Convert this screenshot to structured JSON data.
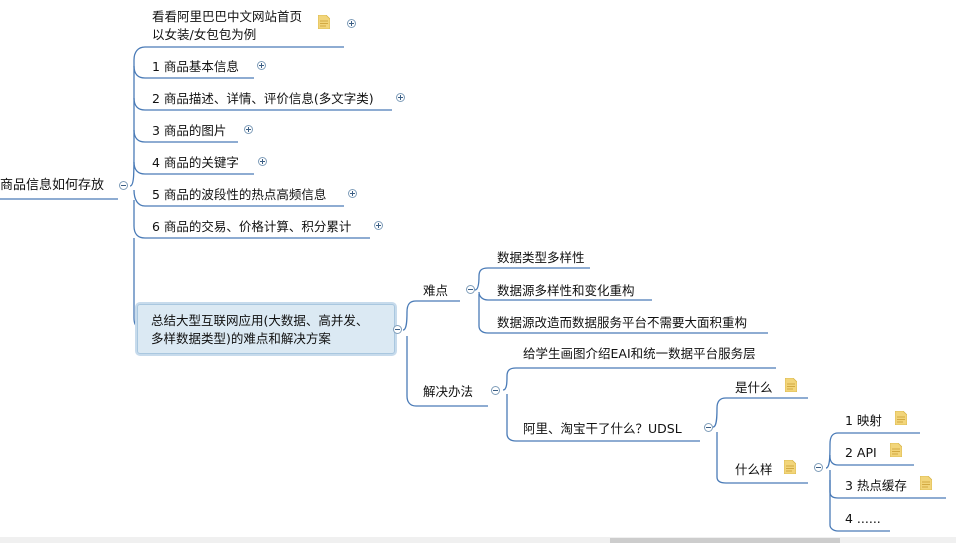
{
  "root": "商品信息如何存放",
  "topics": {
    "homepage": {
      "line1": "看看阿里巴巴中文网站首页",
      "line2": "以女装/女包包为例"
    },
    "t1": "1 商品基本信息",
    "t2": "2 商品描述、详情、评价信息(多文字类)",
    "t3": "3 商品的图片",
    "t4": "4 商品的关键字",
    "t5": "5 商品的波段性的热点高频信息",
    "t6": "6 商品的交易、价格计算、积分累计"
  },
  "summary": {
    "line1": "总结大型互联网应用(大数据、高并发、",
    "line2": "多样数据类型)的难点和解决方案"
  },
  "difficulty": {
    "label": "难点",
    "items": [
      "数据类型多样性",
      "数据源多样性和变化重构",
      "数据源改造而数据服务平台不需要大面积重构"
    ]
  },
  "solution": {
    "label": "解决办法",
    "eai": "给学生画图介绍EAI和统一数据平台服务层",
    "udsl": "阿里、淘宝干了什么？UDSL",
    "what": "是什么",
    "how": "什么样",
    "how_items": [
      "1  映射",
      "2  API",
      "3  热点缓存",
      "4  ......"
    ]
  },
  "colors": {
    "line": "#4a7bb7",
    "note": "#f2d57a",
    "selected_fill": "#dbe9f3"
  }
}
